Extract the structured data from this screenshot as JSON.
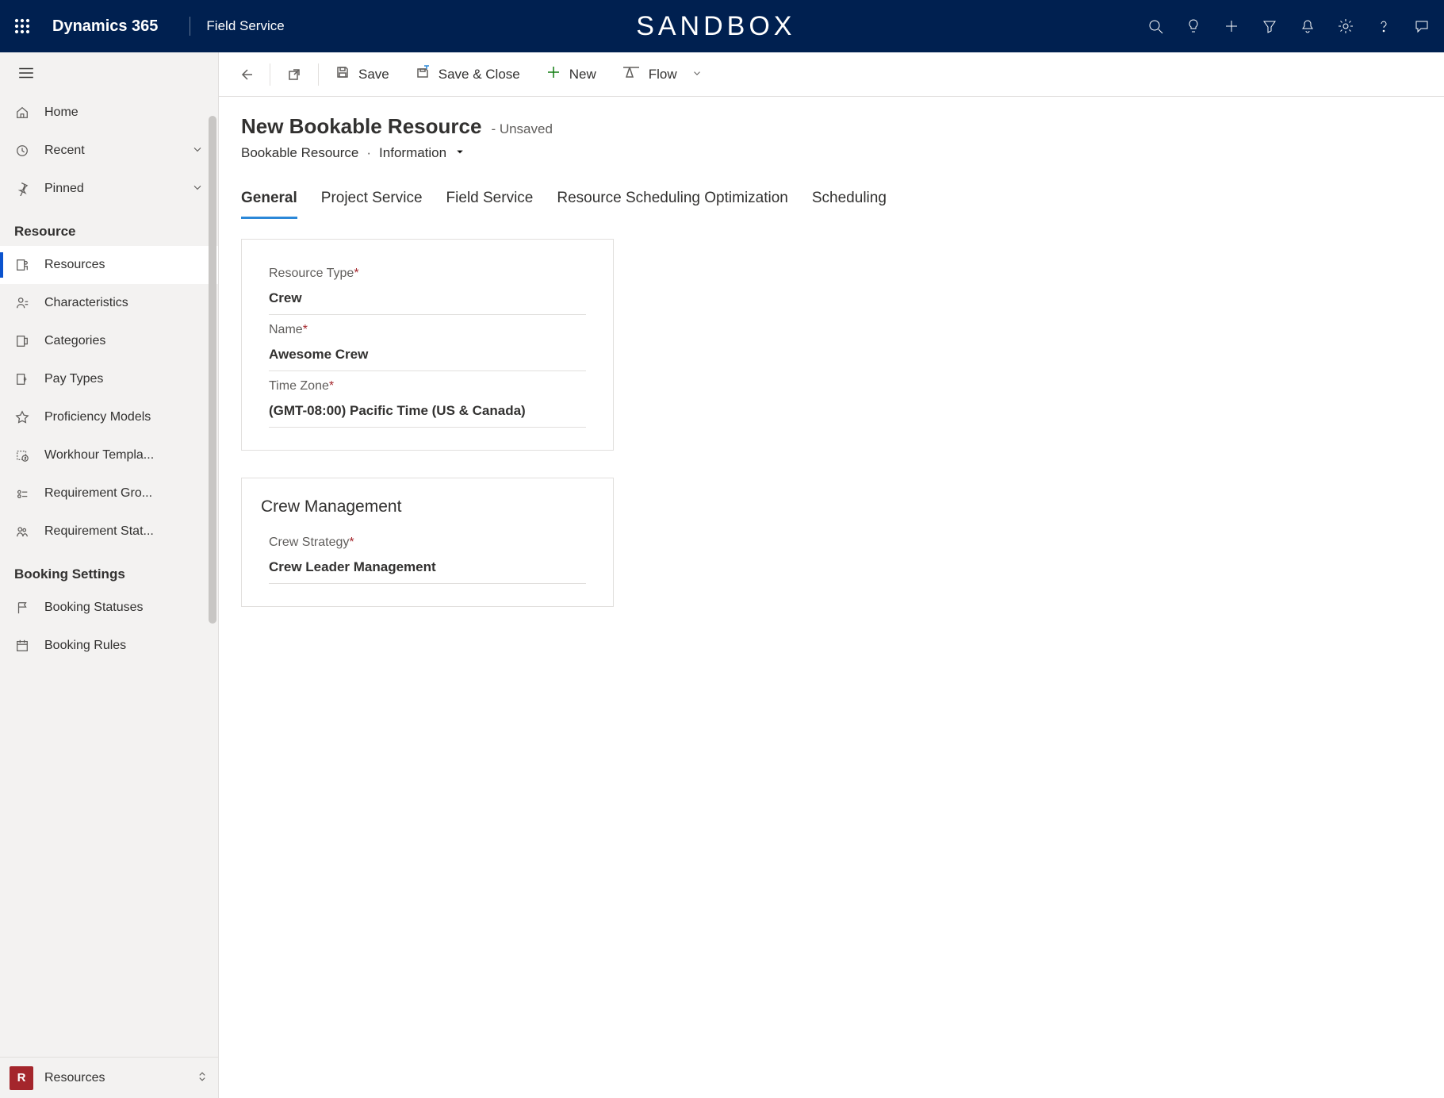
{
  "header": {
    "brand": "Dynamics 365",
    "app": "Field Service",
    "environment": "SANDBOX"
  },
  "sidebar": {
    "home": "Home",
    "recent": "Recent",
    "pinned": "Pinned",
    "groups": [
      {
        "title": "Resource",
        "items": [
          {
            "label": "Resources",
            "selected": true
          },
          {
            "label": "Characteristics"
          },
          {
            "label": "Categories"
          },
          {
            "label": "Pay Types"
          },
          {
            "label": "Proficiency Models"
          },
          {
            "label": "Workhour Templa..."
          },
          {
            "label": "Requirement Gro..."
          },
          {
            "label": "Requirement Stat..."
          }
        ]
      },
      {
        "title": "Booking Settings",
        "items": [
          {
            "label": "Booking Statuses"
          },
          {
            "label": "Booking Rules"
          }
        ]
      }
    ],
    "area": {
      "initial": "R",
      "label": "Resources"
    }
  },
  "commandbar": {
    "save": "Save",
    "save_close": "Save & Close",
    "new": "New",
    "flow": "Flow"
  },
  "form": {
    "title": "New Bookable Resource",
    "status": "- Unsaved",
    "entity": "Bookable Resource",
    "view": "Information",
    "tabs": [
      "General",
      "Project Service",
      "Field Service",
      "Resource Scheduling Optimization",
      "Scheduling"
    ],
    "active_tab": 0,
    "section1": {
      "resource_type_label": "Resource Type",
      "resource_type_value": "Crew",
      "name_label": "Name",
      "name_value": "Awesome Crew",
      "timezone_label": "Time Zone",
      "timezone_value": "(GMT-08:00) Pacific Time (US & Canada)"
    },
    "section2": {
      "title": "Crew Management",
      "strategy_label": "Crew Strategy",
      "strategy_value": "Crew Leader Management"
    }
  }
}
